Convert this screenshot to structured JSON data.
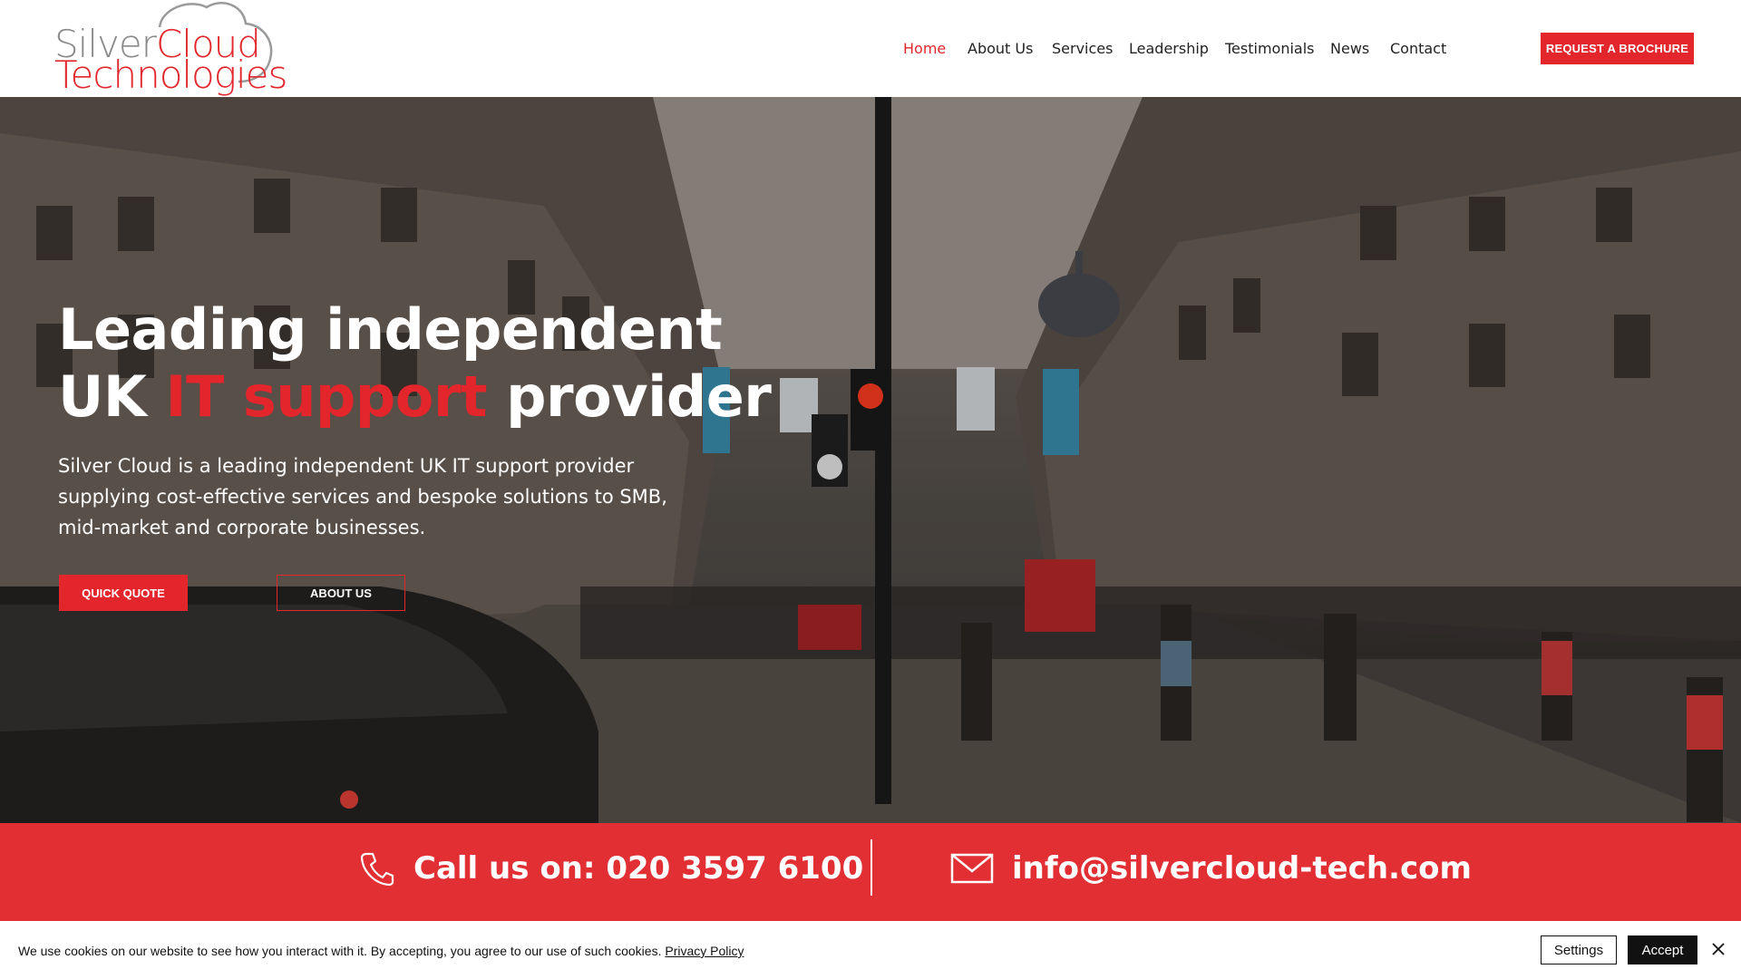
{
  "logo": {
    "line1_silver": "Silver",
    "line1_cloud": "Cloud",
    "line2": "Technologies",
    "icon": "cloud-logo-icon"
  },
  "nav": {
    "items": [
      {
        "label": "Home",
        "active": true
      },
      {
        "label": "About Us",
        "active": false
      },
      {
        "label": "Services",
        "active": false
      },
      {
        "label": "Leadership",
        "active": false
      },
      {
        "label": "Testimonials",
        "active": false
      },
      {
        "label": "News",
        "active": false
      },
      {
        "label": "Contact",
        "active": false
      }
    ],
    "cta": "REQUEST A BROCHURE"
  },
  "hero": {
    "title_line1": "Leading independent",
    "title_line2_a": "UK",
    "title_line2_red": "IT support",
    "title_line2_b": "provider",
    "description": "Silver Cloud is a leading independent UK IT support provider supplying cost-effective services and bespoke solutions to SMB, mid-market and corporate businesses.",
    "btn_quote": "QUICK QUOTE",
    "btn_about": "ABOUT US"
  },
  "contact": {
    "phone": "Call us on: 020 3597 6100",
    "email": "info@silvercloud-tech.com",
    "phone_icon": "phone-icon",
    "email_icon": "envelope-icon"
  },
  "cookie": {
    "text": "We use cookies on our website to see how you interact with it. By accepting, you agree to our use of such cookies.",
    "link": "Privacy Policy",
    "settings": "Settings",
    "accept": "Accept"
  },
  "colors": {
    "accent": "#e2262b",
    "contact_bar": "#e12f33",
    "dark": "#111111"
  }
}
